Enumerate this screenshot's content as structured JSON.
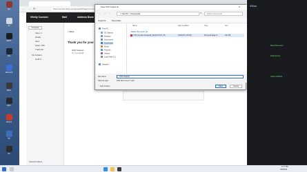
{
  "desktop": {
    "icons": [
      {
        "label": "Ga",
        "color": "#8a3b2f"
      },
      {
        "label": "Ac",
        "color": "#cfd8e2"
      },
      {
        "label": "NEXT",
        "color": "#1d1d1d"
      },
      {
        "label": "Ste",
        "color": "#1b2838"
      },
      {
        "label": "Microsoft",
        "color": "#3c6fd1"
      },
      {
        "label": "Beat",
        "color": "#3a3a3a"
      },
      {
        "label": "Epic",
        "color": "#2a2a2a"
      },
      {
        "label": "Games",
        "color": "#c83a2e"
      },
      {
        "label": "Wi",
        "color": "#3d6fbe"
      },
      {
        "label": "Ho",
        "color": "#2d2d2d"
      }
    ]
  },
  "browser": {
    "url": "https://connect.xfinity.com/appsuite/#!!&app=io.ox/mail",
    "nav": {
      "brand": "Xfinity Connect",
      "mail": "Mail",
      "address_book": "Address Book"
    },
    "compose_label": "Compose",
    "folders": [
      {
        "label": "Inbox",
        "count": "1"
      },
      {
        "label": "Drafts",
        "count": ""
      },
      {
        "label": "Sent",
        "count": ""
      },
      {
        "label": "Spam",
        "count": "196"
      },
      {
        "label": "Trash",
        "count": "30"
      },
      {
        "label": "My Folders",
        "count": ""
      },
      {
        "label": "Hold",
        "count": "0"
      }
    ],
    "back_label": "Back",
    "message_title": "Thank you for your p",
    "sender_line": "USS Support",
    "to_line": "To: no-reply@...",
    "footer_folders": "Virtual Folders"
  },
  "right_panel": {
    "title": "William",
    "names": [
      "BlackSheeder",
      "WarHeiros",
      "Warlord2023"
    ]
  },
  "dialog": {
    "title": "Save Print Output As",
    "path": "> This PC > Downloads",
    "search_placeholder": "Search Downloads",
    "organize": "Organize",
    "new_folder": "New folder",
    "sidebar": [
      {
        "label": "This PC",
        "color": "#5a8bd6"
      },
      {
        "label": "3D Objects",
        "color": "#7aa9e0"
      },
      {
        "label": "Desktop",
        "color": "#5a9fd8"
      },
      {
        "label": "Documents",
        "color": "#6c8fc8"
      },
      {
        "label": "Downloads",
        "color": "#3a7bd5"
      },
      {
        "label": "Music",
        "color": "#e07b39"
      },
      {
        "label": "Pictures",
        "color": "#4aa0d8"
      },
      {
        "label": "Videos",
        "color": "#7a5cc8"
      },
      {
        "label": "Local Disk (C:)",
        "color": "#8a8a8a"
      },
      {
        "label": "Network",
        "color": "#5a8bd6"
      }
    ],
    "columns": {
      "name": "Name",
      "modified": "Date modified",
      "type": "Type",
      "size": "Size"
    },
    "group": "Earlier this month (1)",
    "file": {
      "name": "FTR_Overall_Scaqtaq5_SEQUOYAH_US...",
      "modified": "2/5/2023 1:33 AM",
      "type": "Microsoft Edge P...",
      "size": "180 KB"
    },
    "filename_label": "File name:",
    "filename_value": "USS Support",
    "savetype_label": "Save as type:",
    "savetype_value": "PDF Document (*.pdf)",
    "hide_folders": "Hide Folders",
    "save": "Save",
    "cancel": "Cancel"
  },
  "taskbar": {
    "time": "4:17 PM",
    "date": "2/6/2023"
  }
}
